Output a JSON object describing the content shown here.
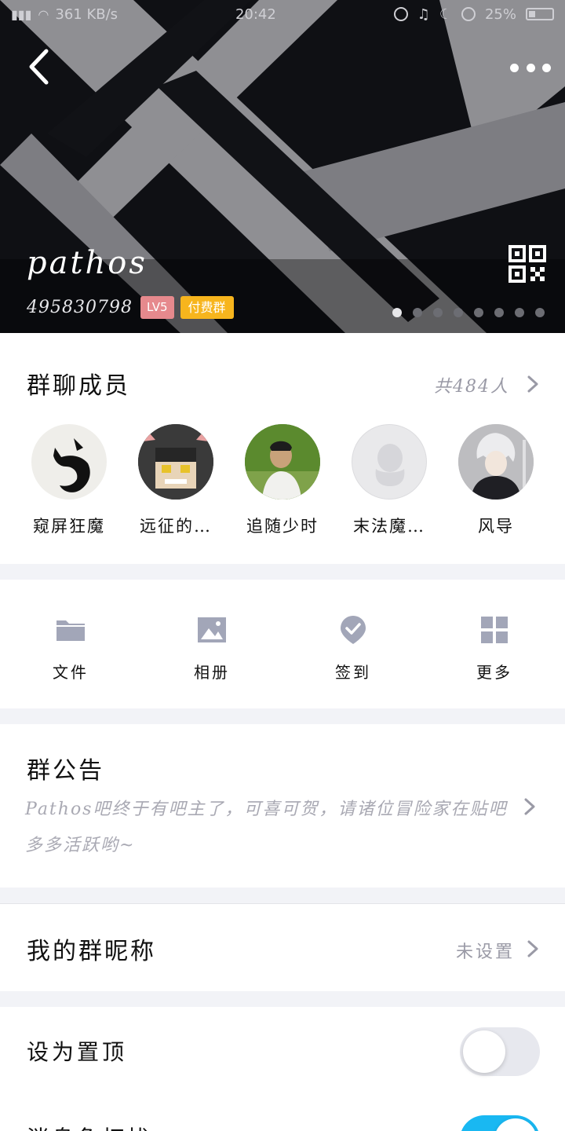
{
  "status_bar": {
    "speed": "361 KB/s",
    "time": "20:42",
    "battery": "25%"
  },
  "header": {
    "group_name": "pathos",
    "group_id": "495830798",
    "level_badge": "LV5",
    "paid_badge": "付费群",
    "page_count": 8,
    "active_page": 1
  },
  "members": {
    "title": "群聊成员",
    "count_label": "共484人",
    "list": [
      {
        "name": "窥屏狂魔",
        "avatar": "black-cat-avatar"
      },
      {
        "name": "远征的…",
        "avatar": "pixel-character-avatar"
      },
      {
        "name": "追随少时",
        "avatar": "young-man-avatar"
      },
      {
        "name": "末法魔…",
        "avatar": "default-penguin-avatar"
      },
      {
        "name": "风导",
        "avatar": "anime-character-avatar"
      }
    ]
  },
  "tools": {
    "items": [
      {
        "label": "文件",
        "icon": "folder-icon"
      },
      {
        "label": "相册",
        "icon": "image-icon"
      },
      {
        "label": "签到",
        "icon": "checkin-icon"
      },
      {
        "label": "更多",
        "icon": "grid-icon"
      }
    ]
  },
  "notice": {
    "title": "群公告",
    "text": "Pathos吧终于有吧主了，可喜可贺，请诸位冒险家在贴吧多多活跃哟~"
  },
  "nickname": {
    "title": "我的群昵称",
    "value": "未设置"
  },
  "settings": {
    "items": [
      {
        "label": "设为置顶",
        "enabled": false
      },
      {
        "label": "消息免打扰",
        "enabled": true
      }
    ]
  },
  "colors": {
    "accent": "#19b8f2",
    "level_badge": "#e6898d",
    "paid_badge": "#f7b51d",
    "secondary_text": "#9a9aa6"
  }
}
